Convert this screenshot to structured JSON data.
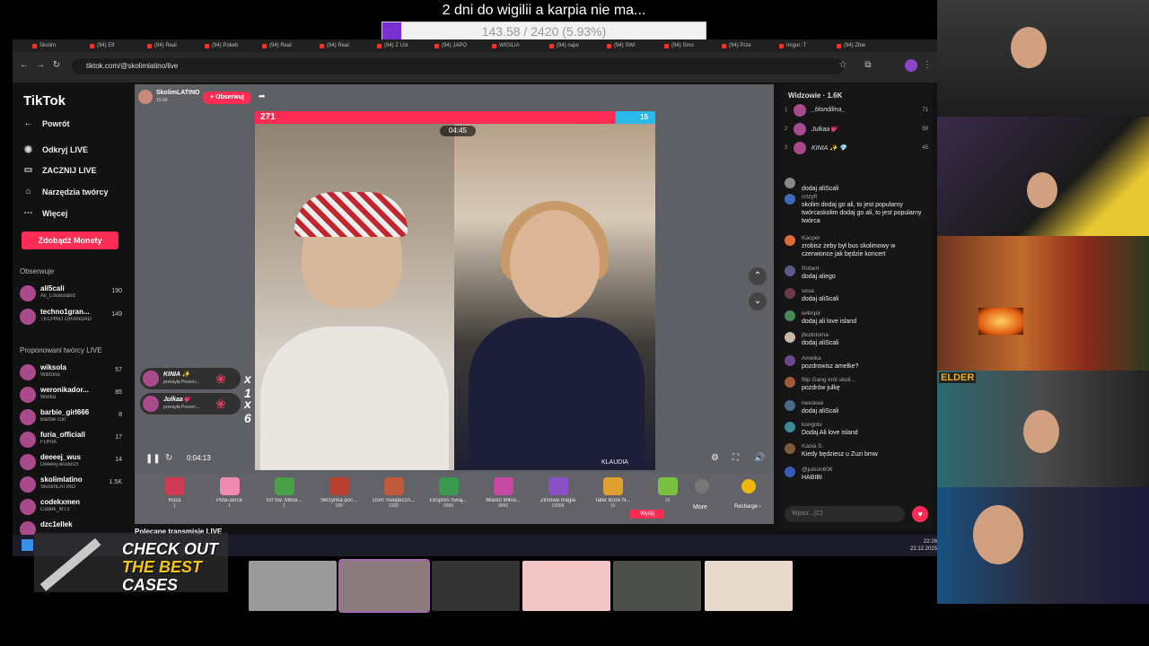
{
  "goal": {
    "title": "2 dni do wigilii a karpia nie ma...",
    "progress_text": "143.58 / 2420 (5.93%)",
    "progress": 0.0593
  },
  "browser": {
    "tabs": [
      "Skolim",
      "(94) Elf",
      "(94) Real",
      "(94) Pokeb",
      "(94) Real",
      "(94) Real",
      "(94) Z Ust",
      "(94) JAPO",
      "WIGILIA",
      "(94) najw",
      "(94) SWI",
      "(94) Smo",
      "(94) Prze",
      "Imgur: T",
      "(94) Zbie"
    ],
    "url": "tiktok.com/@skolimlatino/live"
  },
  "sidebar": {
    "logo": "TikTok",
    "nav": [
      {
        "label": "Powrót",
        "icon": "←"
      },
      {
        "label": "Odkryj LIVE",
        "icon": "◉"
      },
      {
        "label": "ZACZNIJ LIVE",
        "icon": "▭"
      },
      {
        "label": "Narzędzia twórcy",
        "icon": "⌂"
      },
      {
        "label": "Więcej",
        "icon": "⋯"
      }
    ],
    "coins_button": "Zdobądź Monety",
    "following_header": "Obserwuje",
    "following": [
      {
        "name": "ali5cali",
        "sub": "Ali_Loveisland",
        "count": "190"
      },
      {
        "name": "techno1gran...",
        "sub": "TECHNO GRANDAD",
        "count": "149"
      }
    ],
    "suggested_header": "Proponowani twórcy LIVE",
    "suggested": [
      {
        "name": "wiksola",
        "sub": "Wiktoria",
        "count": "57"
      },
      {
        "name": "weronikador...",
        "sub": "Werka",
        "count": "85"
      },
      {
        "name": "barbie_girl666",
        "sub": "Barbie Girl",
        "count": "8"
      },
      {
        "name": "furia_officiall",
        "sub": "FURIA",
        "count": "17"
      },
      {
        "name": "deeeej_wus",
        "sub": "Deeeej-wuuusS",
        "count": "14"
      },
      {
        "name": "skolimlatino",
        "sub": "SkolimLATINO",
        "count": "1.5K"
      },
      {
        "name": "codekxmen",
        "sub": "Codek_MT2",
        "count": ""
      },
      {
        "name": "dzc1ellek",
        "sub": "",
        "count": ""
      }
    ],
    "recommended_label": "Polecane transmisje LIVE"
  },
  "player": {
    "host_name": "SkolimLATINO",
    "host_likes": "15.6K",
    "follow_label": "+ Obserwuj",
    "score_left": "271",
    "score_right": "15",
    "timer": "04:45",
    "elapsed": "0:04:13",
    "guest_label": "KLAUDIA",
    "gift_notes": [
      {
        "name": "KINIA ✨",
        "sub": "przesyła Prezen...",
        "mult": "x 1"
      },
      {
        "name": "Julkaa💗",
        "sub": "przesyła Prezen...",
        "mult": "x 6"
      }
    ],
    "gifts": [
      {
        "name": "Róża",
        "price": "1"
      },
      {
        "name": "Pufa-serce",
        "price": "1"
      },
      {
        "name": "Elf Św. Mikoł...",
        "price": "1"
      },
      {
        "name": "Skrzynka poc...",
        "price": "199"
      },
      {
        "name": "Dom Świąteczn...",
        "price": "2200"
      },
      {
        "name": "Ekspres Świą...",
        "price": "5999"
      },
      {
        "name": "Miasto Mikoł...",
        "price": "9999"
      },
      {
        "name": "Zimowa magia",
        "price": "19999"
      },
      {
        "name": "Tater Boże N...",
        "price": "10"
      },
      {
        "name": "",
        "price": "10"
      }
    ],
    "send_label": "Wyślij",
    "more_label": "More",
    "recharge_label": "Recharge ›"
  },
  "chat": {
    "viewers_label": "Widzowie · 1.6K",
    "top_viewers": [
      {
        "rank": "1",
        "name": "_blondilina_",
        "count": "71"
      },
      {
        "rank": "2",
        "name": "Julkaa💗",
        "count": "59"
      },
      {
        "rank": "3",
        "name": "KINIA ✨ 💎",
        "count": "45"
      }
    ],
    "messages": [
      {
        "user": "",
        "text": "dodaj aliScali"
      },
      {
        "user": "crtzyfl",
        "text": "skolim dodaj go ali, to jest popularny twórcaskolim dodaj go ali, to jest popularny twórca"
      },
      {
        "user": "Kacper",
        "text": "zrobisz żeby był bus skolimowy w czerwionce jak będzie koncert"
      },
      {
        "user": "Robert",
        "text": "dodaj aliego"
      },
      {
        "user": "sesa",
        "text": "dodaj aliScali"
      },
      {
        "user": "w4mpir",
        "text": "dodaj ali love island"
      },
      {
        "user": "jbcdotoma",
        "text": "dodaj aliScali"
      },
      {
        "user": "Amelka",
        "text": "pozdrowisz amelke?"
      },
      {
        "user": "filip Gang król skoli...",
        "text": "pozdrów julkę"
      },
      {
        "user": "neeskee",
        "text": "dodaj aliScali"
      },
      {
        "user": "kongotv",
        "text": "Dodaj Ali love island"
      },
      {
        "user": "Kasia S.",
        "text": "Kiedy będziesz u Zuzi bmw"
      },
      {
        "user": "@julson606",
        "text": "HABIBI"
      }
    ],
    "input_placeholder": "Wpisz...(C)"
  },
  "taskbar": {
    "time": "22:26",
    "date": "22.12.2025"
  },
  "ad": {
    "line1": "CHECK OUT",
    "line2": "THE BEST",
    "line3": "CASES"
  },
  "overlay": {
    "elder_label": "ELDER"
  },
  "colors": {
    "accent": "#fe2c55",
    "goal_fill": "#7a2fd1",
    "battle_blue": "#2ab9e8"
  }
}
